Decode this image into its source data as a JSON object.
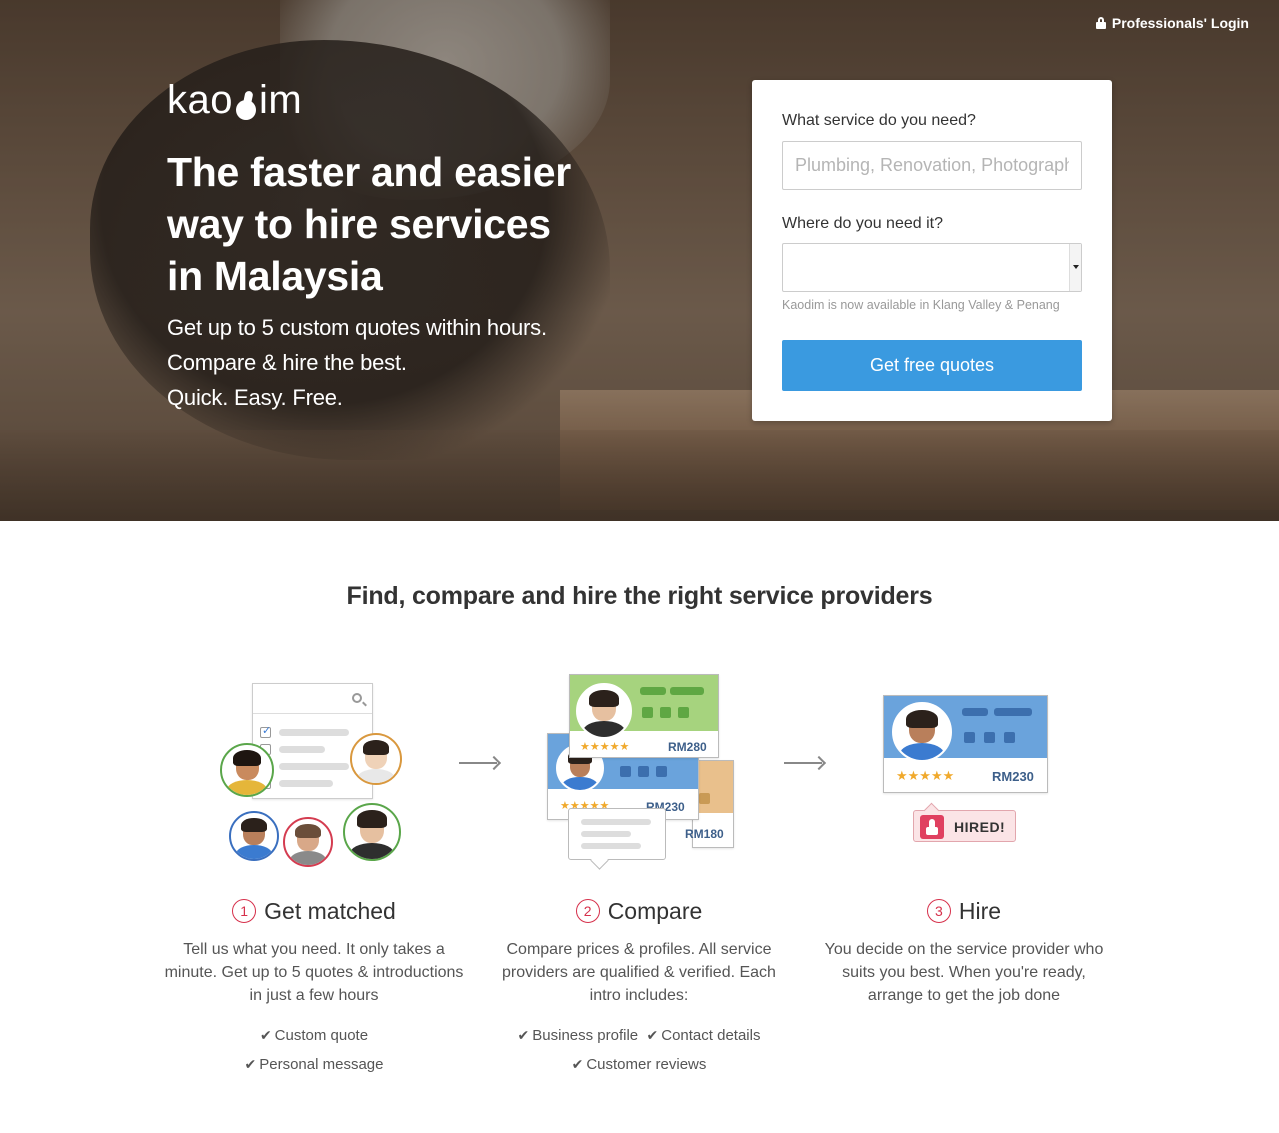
{
  "header": {
    "pro_login": "Professionals' Login",
    "logo_pre": "kao",
    "logo_post": "im"
  },
  "hero": {
    "headline_lines": [
      "The faster and easier",
      "way to hire services",
      "in Malaysia"
    ],
    "sub_lines": [
      "Get up to 5 custom quotes within hours.",
      "Compare & hire the best.",
      "Quick. Easy. Free."
    ]
  },
  "form": {
    "service_label": "What service do you need?",
    "service_placeholder": "Plumbing, Renovation, Photography...",
    "location_label": "Where do you need it?",
    "location_value": "",
    "availability_note": "Kaodim is now available in Klang Valley & Penang",
    "cta_label": "Get free quotes"
  },
  "how": {
    "title": "Find, compare and hire the right service providers",
    "illustration": {
      "prices": [
        "RM280",
        "RM230",
        "RM180"
      ],
      "hire_price": "RM230",
      "stars": "★★★★★",
      "hired_label": "HIRED!"
    },
    "steps": [
      {
        "num": "1",
        "title": "Get matched",
        "desc": "Tell us what you need. It only takes a minute. Get up to 5 quotes & introductions in just a few hours",
        "checks": [
          "Custom quote",
          "Personal message"
        ]
      },
      {
        "num": "2",
        "title": "Compare",
        "desc": "Compare prices & profiles. All service providers are qualified & verified. Each intro includes:",
        "checks": [
          "Business profile",
          "Contact details",
          "Customer reviews"
        ]
      },
      {
        "num": "3",
        "title": "Hire",
        "desc": "You decide on the service provider who suits you best. When you're ready, arrange to get the job done",
        "checks": []
      }
    ]
  },
  "colors": {
    "accent_blue": "#3a9ae0",
    "step_red": "#d6304b",
    "card_green": "#a6d37e",
    "card_blue": "#6aa3dc",
    "card_orange": "#e9c08c"
  }
}
